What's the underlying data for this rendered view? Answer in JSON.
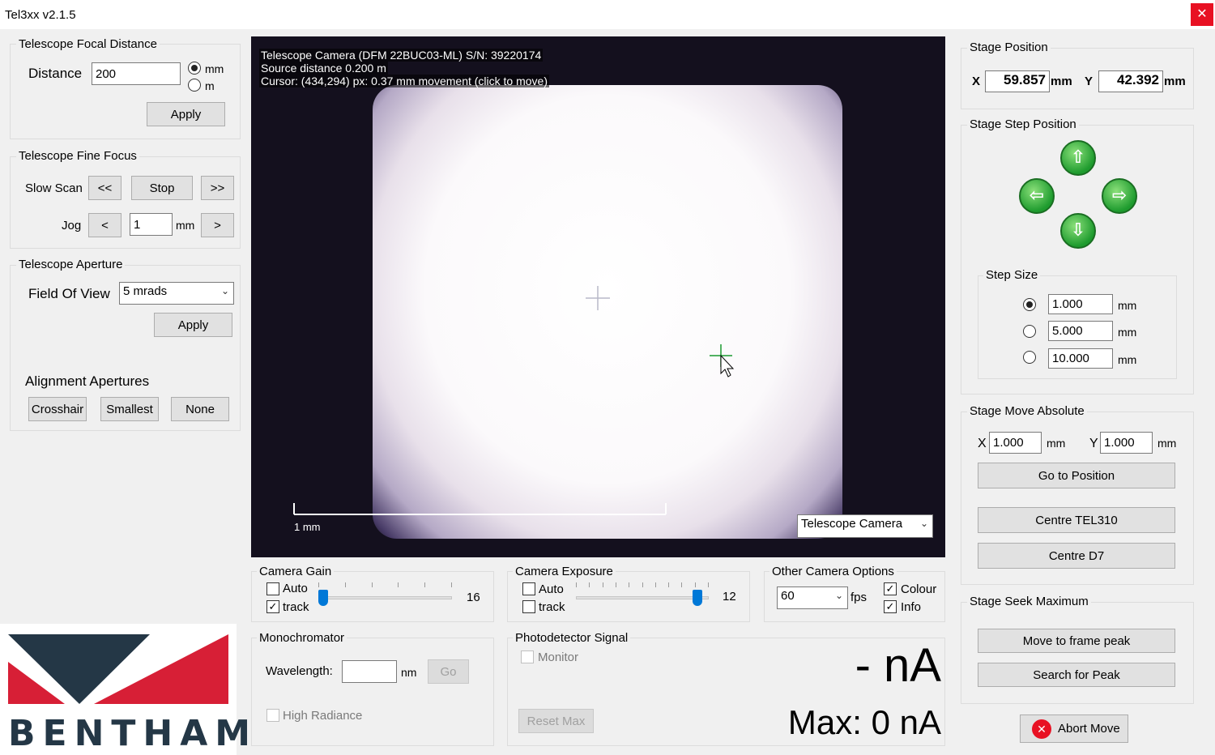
{
  "window": {
    "title": "Tel3xx v2.1.5",
    "close_glyph": "✕"
  },
  "focal": {
    "title": "Telescope Focal Distance",
    "label": "Distance",
    "value": "200",
    "unit_mm": "mm",
    "unit_m": "m",
    "selected": "mm",
    "apply": "Apply"
  },
  "fine_focus": {
    "title": "Telescope Fine Focus",
    "slow_scan": "Slow Scan",
    "rewind": "<<",
    "stop": "Stop",
    "forward": ">>",
    "jog": "Jog",
    "jog_back": "<",
    "jog_value": "1",
    "jog_unit": "mm",
    "jog_fwd": ">"
  },
  "aperture": {
    "title": "Telescope Aperture",
    "fov_label": "Field Of View",
    "fov_value": "5 mrads",
    "apply": "Apply",
    "align_label": "Alignment Apertures",
    "crosshair": "Crosshair",
    "smallest": "Smallest",
    "none": "None"
  },
  "camera": {
    "line1": "Telescope Camera (DFM 22BUC03-ML) S/N: 39220174",
    "line2": "Source distance 0.200 m",
    "line3": "Cursor: (434,294) px: 0.37 mm movement (click to move)",
    "scale_label": "1 mm",
    "source": "Telescope Camera"
  },
  "gain": {
    "title": "Camera Gain",
    "auto": "Auto",
    "track": "track",
    "auto_checked": false,
    "track_checked": true,
    "value": "16",
    "level": 0.0
  },
  "exposure": {
    "title": "Camera Exposure",
    "auto": "Auto",
    "track": "track",
    "auto_checked": false,
    "track_checked": false,
    "value": "12",
    "level": 1.0
  },
  "other": {
    "title": "Other Camera Options",
    "fps_value": "60",
    "fps_unit": "fps",
    "colour": "Colour",
    "info": "Info",
    "colour_checked": true,
    "info_checked": true
  },
  "mono": {
    "title": "Monochromator",
    "wavelength": "Wavelength:",
    "unit": "nm",
    "go": "Go",
    "high_radiance": "High Radiance"
  },
  "photo": {
    "title": "Photodetector Signal",
    "monitor": "Monitor",
    "reset": "Reset Max",
    "signal": "- nA",
    "max": "Max: 0 nA"
  },
  "stage_pos": {
    "title": "Stage Position",
    "x_label": "X",
    "x_value": "59.857",
    "x_unit": "mm",
    "y_label": "Y",
    "y_value": "42.392",
    "y_unit": "mm"
  },
  "stage_step": {
    "title": "Stage Step Position",
    "up": "⇧",
    "left": "⇦",
    "right": "⇨",
    "down": "⇩",
    "step_title": "Step Size",
    "steps": [
      {
        "value": "1.000",
        "unit": "mm"
      },
      {
        "value": "5.000",
        "unit": "mm"
      },
      {
        "value": "10.000",
        "unit": "mm"
      }
    ],
    "selected": 0
  },
  "stage_abs": {
    "title": "Stage Move Absolute",
    "x_label": "X",
    "x_value": "1.000",
    "x_unit": "mm",
    "y_label": "Y",
    "y_value": "1.000",
    "y_unit": "mm",
    "goto": "Go to Position",
    "centre1": "Centre TEL310",
    "centre2": "Centre D7"
  },
  "seek": {
    "title": "Stage Seek Maximum",
    "frame_peak": "Move to frame peak",
    "search": "Search for Peak"
  },
  "abort": {
    "label": "Abort Move",
    "icon_glyph": "✕"
  },
  "logo": {
    "text": "BENTHAM",
    "colors": {
      "dark": "#243746",
      "red": "#d71f36"
    }
  }
}
